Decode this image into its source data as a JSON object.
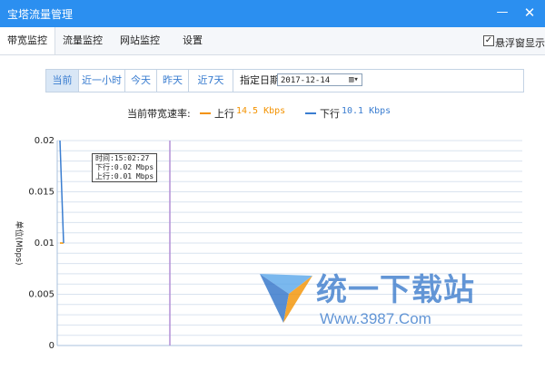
{
  "window": {
    "title": "宝塔流量管理",
    "minimize_label": "—",
    "close_label": "✕"
  },
  "tabs": [
    {
      "label": "带宽监控",
      "active": true
    },
    {
      "label": "流量监控",
      "active": false
    },
    {
      "label": "网站监控",
      "active": false
    },
    {
      "label": "设置",
      "active": false
    }
  ],
  "float_window": {
    "label": "悬浮窗显示",
    "checked": true,
    "check_mark": "✓"
  },
  "range_buttons": [
    {
      "label": "当前",
      "active": true
    },
    {
      "label": "近一小时",
      "active": false
    },
    {
      "label": "今天",
      "active": false
    },
    {
      "label": "昨天",
      "active": false
    },
    {
      "label": "近7天",
      "active": false
    }
  ],
  "date_filter": {
    "label": "指定日期",
    "value": "2017-12-14",
    "icon": "calendar-icon"
  },
  "rate": {
    "title": "当前带宽速率:",
    "upload_label": "上行",
    "upload_value": "14.5 Kbps",
    "download_label": "下行",
    "download_value": "10.1 Kbps"
  },
  "tooltip": {
    "time": "时间:15:02:27",
    "down": "下行:0.02 Mbps",
    "up": "上行:0.01 Mbps"
  },
  "watermark": {
    "text": "统一下载站",
    "url": "Www.3987.Com"
  },
  "colors": {
    "titlebar": "#2b8ff0",
    "upload": "#f39200",
    "download": "#3a7dd0",
    "cursor_line": "#b38fd6"
  },
  "chart_data": {
    "type": "line",
    "ylabel": "单位(Mbps)",
    "yticks": [
      "0.02",
      "0.015",
      "0.01",
      "0.005",
      "0"
    ],
    "ylim": [
      0,
      0.02
    ],
    "grid": true,
    "series": [
      {
        "name": "上行",
        "values": [
          0.01,
          0.01
        ],
        "color": "#f39200"
      },
      {
        "name": "下行",
        "values": [
          0.02,
          0.01
        ],
        "color": "#3a7dd0"
      }
    ]
  }
}
